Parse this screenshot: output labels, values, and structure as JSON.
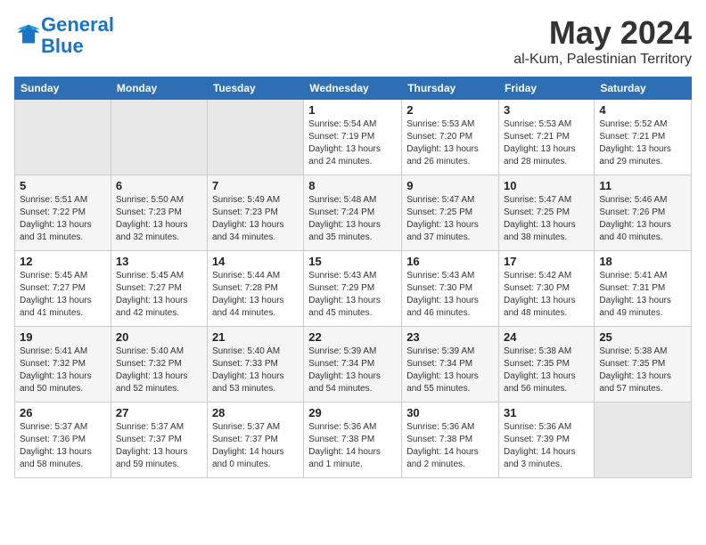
{
  "logo": {
    "line1": "General",
    "line2": "Blue"
  },
  "title": "May 2024",
  "subtitle": "al-Kum, Palestinian Territory",
  "headers": [
    "Sunday",
    "Monday",
    "Tuesday",
    "Wednesday",
    "Thursday",
    "Friday",
    "Saturday"
  ],
  "weeks": [
    [
      {
        "day": "",
        "info": ""
      },
      {
        "day": "",
        "info": ""
      },
      {
        "day": "",
        "info": ""
      },
      {
        "day": "1",
        "info": "Sunrise: 5:54 AM\nSunset: 7:19 PM\nDaylight: 13 hours\nand 24 minutes."
      },
      {
        "day": "2",
        "info": "Sunrise: 5:53 AM\nSunset: 7:20 PM\nDaylight: 13 hours\nand 26 minutes."
      },
      {
        "day": "3",
        "info": "Sunrise: 5:53 AM\nSunset: 7:21 PM\nDaylight: 13 hours\nand 28 minutes."
      },
      {
        "day": "4",
        "info": "Sunrise: 5:52 AM\nSunset: 7:21 PM\nDaylight: 13 hours\nand 29 minutes."
      }
    ],
    [
      {
        "day": "5",
        "info": "Sunrise: 5:51 AM\nSunset: 7:22 PM\nDaylight: 13 hours\nand 31 minutes."
      },
      {
        "day": "6",
        "info": "Sunrise: 5:50 AM\nSunset: 7:23 PM\nDaylight: 13 hours\nand 32 minutes."
      },
      {
        "day": "7",
        "info": "Sunrise: 5:49 AM\nSunset: 7:23 PM\nDaylight: 13 hours\nand 34 minutes."
      },
      {
        "day": "8",
        "info": "Sunrise: 5:48 AM\nSunset: 7:24 PM\nDaylight: 13 hours\nand 35 minutes."
      },
      {
        "day": "9",
        "info": "Sunrise: 5:47 AM\nSunset: 7:25 PM\nDaylight: 13 hours\nand 37 minutes."
      },
      {
        "day": "10",
        "info": "Sunrise: 5:47 AM\nSunset: 7:25 PM\nDaylight: 13 hours\nand 38 minutes."
      },
      {
        "day": "11",
        "info": "Sunrise: 5:46 AM\nSunset: 7:26 PM\nDaylight: 13 hours\nand 40 minutes."
      }
    ],
    [
      {
        "day": "12",
        "info": "Sunrise: 5:45 AM\nSunset: 7:27 PM\nDaylight: 13 hours\nand 41 minutes."
      },
      {
        "day": "13",
        "info": "Sunrise: 5:45 AM\nSunset: 7:27 PM\nDaylight: 13 hours\nand 42 minutes."
      },
      {
        "day": "14",
        "info": "Sunrise: 5:44 AM\nSunset: 7:28 PM\nDaylight: 13 hours\nand 44 minutes."
      },
      {
        "day": "15",
        "info": "Sunrise: 5:43 AM\nSunset: 7:29 PM\nDaylight: 13 hours\nand 45 minutes."
      },
      {
        "day": "16",
        "info": "Sunrise: 5:43 AM\nSunset: 7:30 PM\nDaylight: 13 hours\nand 46 minutes."
      },
      {
        "day": "17",
        "info": "Sunrise: 5:42 AM\nSunset: 7:30 PM\nDaylight: 13 hours\nand 48 minutes."
      },
      {
        "day": "18",
        "info": "Sunrise: 5:41 AM\nSunset: 7:31 PM\nDaylight: 13 hours\nand 49 minutes."
      }
    ],
    [
      {
        "day": "19",
        "info": "Sunrise: 5:41 AM\nSunset: 7:32 PM\nDaylight: 13 hours\nand 50 minutes."
      },
      {
        "day": "20",
        "info": "Sunrise: 5:40 AM\nSunset: 7:32 PM\nDaylight: 13 hours\nand 52 minutes."
      },
      {
        "day": "21",
        "info": "Sunrise: 5:40 AM\nSunset: 7:33 PM\nDaylight: 13 hours\nand 53 minutes."
      },
      {
        "day": "22",
        "info": "Sunrise: 5:39 AM\nSunset: 7:34 PM\nDaylight: 13 hours\nand 54 minutes."
      },
      {
        "day": "23",
        "info": "Sunrise: 5:39 AM\nSunset: 7:34 PM\nDaylight: 13 hours\nand 55 minutes."
      },
      {
        "day": "24",
        "info": "Sunrise: 5:38 AM\nSunset: 7:35 PM\nDaylight: 13 hours\nand 56 minutes."
      },
      {
        "day": "25",
        "info": "Sunrise: 5:38 AM\nSunset: 7:35 PM\nDaylight: 13 hours\nand 57 minutes."
      }
    ],
    [
      {
        "day": "26",
        "info": "Sunrise: 5:37 AM\nSunset: 7:36 PM\nDaylight: 13 hours\nand 58 minutes."
      },
      {
        "day": "27",
        "info": "Sunrise: 5:37 AM\nSunset: 7:37 PM\nDaylight: 13 hours\nand 59 minutes."
      },
      {
        "day": "28",
        "info": "Sunrise: 5:37 AM\nSunset: 7:37 PM\nDaylight: 14 hours\nand 0 minutes."
      },
      {
        "day": "29",
        "info": "Sunrise: 5:36 AM\nSunset: 7:38 PM\nDaylight: 14 hours\nand 1 minute."
      },
      {
        "day": "30",
        "info": "Sunrise: 5:36 AM\nSunset: 7:38 PM\nDaylight: 14 hours\nand 2 minutes."
      },
      {
        "day": "31",
        "info": "Sunrise: 5:36 AM\nSunset: 7:39 PM\nDaylight: 14 hours\nand 3 minutes."
      },
      {
        "day": "",
        "info": ""
      }
    ]
  ]
}
